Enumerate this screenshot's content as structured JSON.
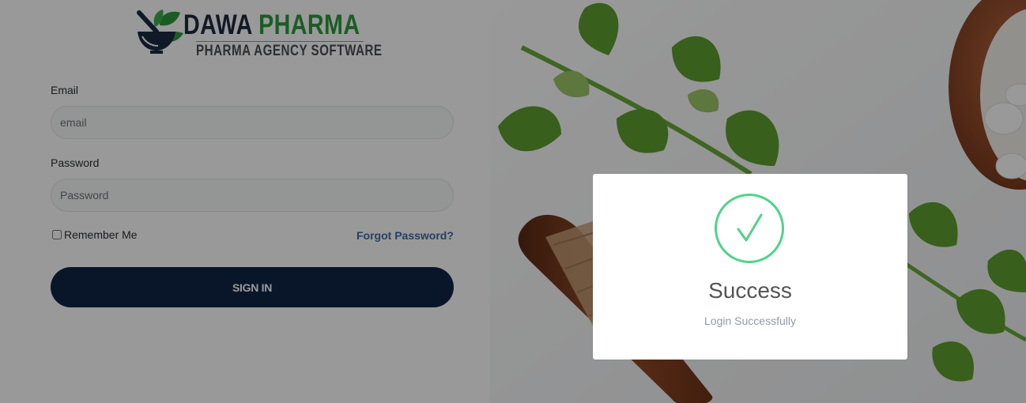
{
  "brand": {
    "title_part1": "DAWA",
    "title_part2": "PHARMA",
    "subtitle": "PHARMA AGENCY SOFTWARE",
    "colors": {
      "navy": "#1b2a41",
      "green": "#2e9a3f"
    }
  },
  "login": {
    "email_label": "Email",
    "email_placeholder": "email",
    "password_label": "Password",
    "password_placeholder": "Password",
    "remember_label": "Remember Me",
    "remember_checked": false,
    "forgot_label": "Forgot Password?",
    "signin_label": "SIGN IN",
    "signin_color": "#0f2545"
  },
  "modal": {
    "icon": "check-icon",
    "title": "Success",
    "message": "Login Successfully",
    "accent": "#4fd38a"
  }
}
